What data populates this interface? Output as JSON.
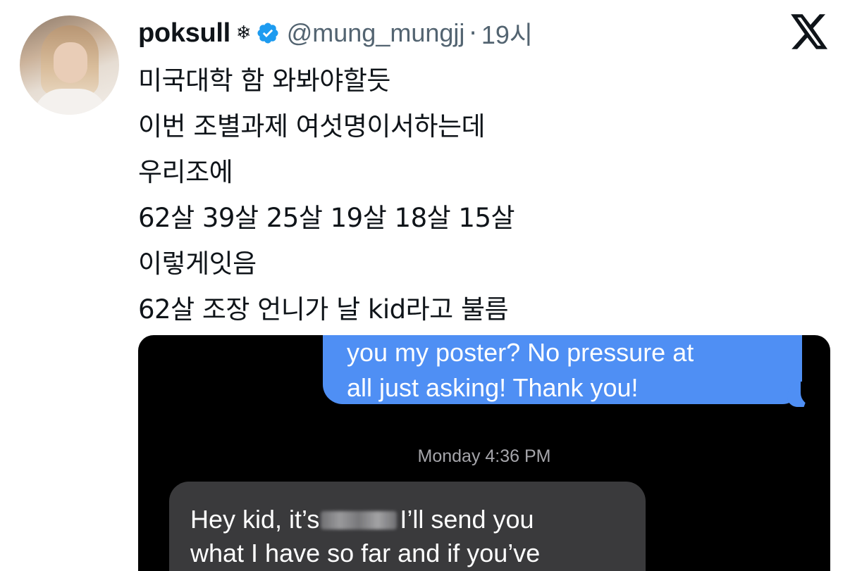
{
  "user": {
    "name": "poksull",
    "badge_glyph": "❄",
    "handle": "@mung_mungjj",
    "separator": "·",
    "time": "19시",
    "verified_color": "#1d9bf0",
    "avatar_icon": "profile-photo"
  },
  "platform": {
    "logo_icon": "x-logo"
  },
  "tweet": {
    "lines": [
      "미국대학 함 와봐야할듯",
      "이번 조별과제 여섯명이서하는데",
      "우리조에",
      "62살 39살 25살 19살 18살 15살",
      "이렇게잇음",
      "62살 조장 언니가 날 kid라고 불름"
    ]
  },
  "screenshot": {
    "sent_message": {
      "line1": "you my poster? No pressure at",
      "line2": "all just asking! Thank you!",
      "color": "#4f8ff4"
    },
    "timestamp": "Monday 4:36 PM",
    "received_message": {
      "line1_before": "Hey kid, it’s",
      "line1_after": "I’ll send you",
      "line2": "what I have so far and if you’ve",
      "color": "#3a3a3c"
    }
  }
}
